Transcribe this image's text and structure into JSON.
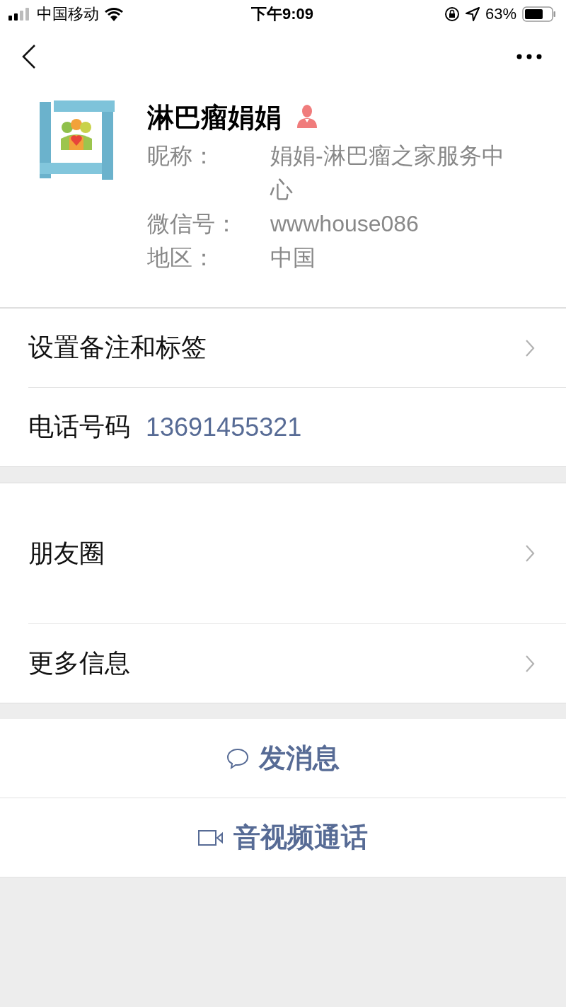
{
  "status_bar": {
    "carrier": "中国移动",
    "time": "下午9:09",
    "battery": "63%"
  },
  "profile": {
    "name": "淋巴瘤娟娟",
    "fields": [
      {
        "label": "昵称：",
        "value": "娟娟-淋巴瘤之家服务中心"
      },
      {
        "label": "微信号：",
        "value": "wwwhouse086"
      },
      {
        "label": "地区：",
        "value": "中国"
      }
    ]
  },
  "groups": [
    [
      {
        "kind": "link",
        "label": "设置备注和标签"
      },
      {
        "kind": "phone",
        "label": "电话号码",
        "value": "13691455321"
      }
    ],
    [
      {
        "kind": "moments",
        "label": "朋友圈"
      },
      {
        "kind": "link",
        "label": "更多信息"
      }
    ]
  ],
  "actions": [
    {
      "kind": "chat",
      "label": "发消息"
    },
    {
      "kind": "video",
      "label": "音视频通话"
    }
  ]
}
